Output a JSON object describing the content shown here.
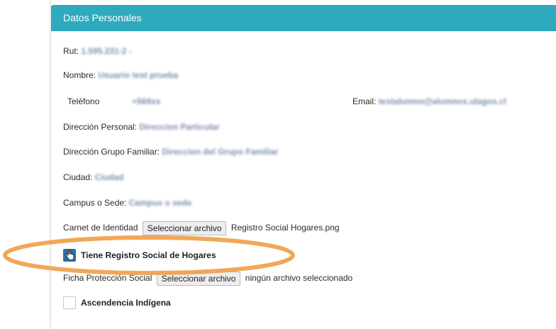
{
  "panel": {
    "title": "Datos Personales"
  },
  "fields": {
    "rut": {
      "label": "Rut:",
      "value": "1.595.231-2 -"
    },
    "nombre": {
      "label": "Nombre:",
      "value": "Usuario test prueba"
    },
    "telefono": {
      "label": "Teléfono",
      "value": "+569xx"
    },
    "email": {
      "label": "Email:",
      "value": "testalumno@alumnos.ulagos.cl"
    },
    "direccion_personal": {
      "label": "Dirección Personal:",
      "value": "Direccion Particular"
    },
    "direccion_familiar": {
      "label": "Dirección Grupo Familiar:",
      "value": "Direccion del Grupo Familiar"
    },
    "ciudad": {
      "label": "Ciudad:",
      "value": "Ciudad"
    },
    "campus": {
      "label": "Campus o Sede:",
      "value": "Campus o sede"
    }
  },
  "carnet": {
    "label": "Carnet de Identidad",
    "button": "Seleccionar archivo",
    "file": "Registro Social Hogares.png"
  },
  "registro_social": {
    "label": "Tiene Registro Social de Hogares",
    "checked": true
  },
  "ficha": {
    "label": "Ficha Protección Social",
    "button": "Seleccionar archivo",
    "file": "ningún archivo seleccionado"
  },
  "ascendencia": {
    "label": "Ascendencia Indígena",
    "checked": false
  },
  "colors": {
    "header": "#2fa9bd",
    "highlight": "#f0a04b",
    "checkbox_checked": "#2c6fa8"
  }
}
